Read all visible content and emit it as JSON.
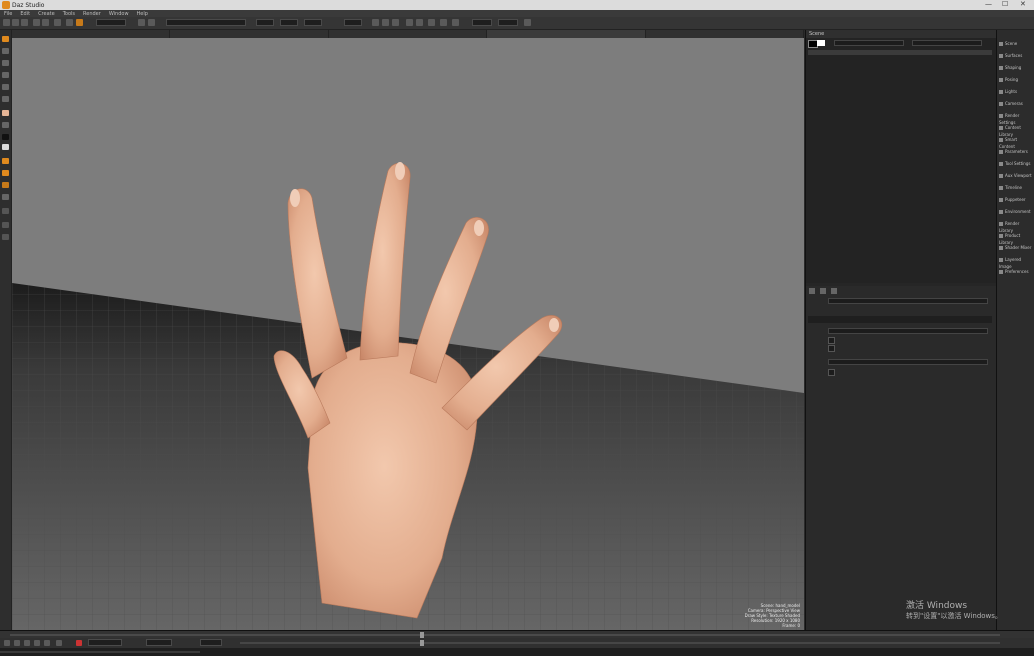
{
  "window": {
    "title": "Daz Studio",
    "controls": {
      "minimize": "—",
      "maximize": "☐",
      "close": "✕"
    }
  },
  "menu": {
    "items": [
      "File",
      "Edit",
      "Create",
      "Tools",
      "Render",
      "Window",
      "Help"
    ]
  },
  "viewport": {
    "info_lines": [
      "Scene: hand_model",
      "Camera: Perspective View",
      "Draw Style: Texture Shaded",
      "Resolution: 1920 x 1080",
      "Frame: 0"
    ]
  },
  "right_panel": {
    "header_title": "Scene"
  },
  "tool_column": {
    "items": [
      "Scene",
      "Surfaces",
      "Shaping",
      "Posing",
      "Lights",
      "Cameras",
      "Render Settings",
      "Content Library",
      "Smart Content",
      "Parameters",
      "Tool Settings",
      "Aux Viewport",
      "Timeline",
      "Puppeteer",
      "Environment",
      "Render Library",
      "Product Library",
      "Shader Mixer",
      "Layered Image",
      "Preferences"
    ]
  },
  "watermark": {
    "line1": "激活 Windows",
    "line2": "转到\"设置\"以激活 Windows。"
  },
  "colors": {
    "accent": "#e08a1e",
    "viewport_bg": "#7d7d7d",
    "skin": "#e6b596"
  }
}
